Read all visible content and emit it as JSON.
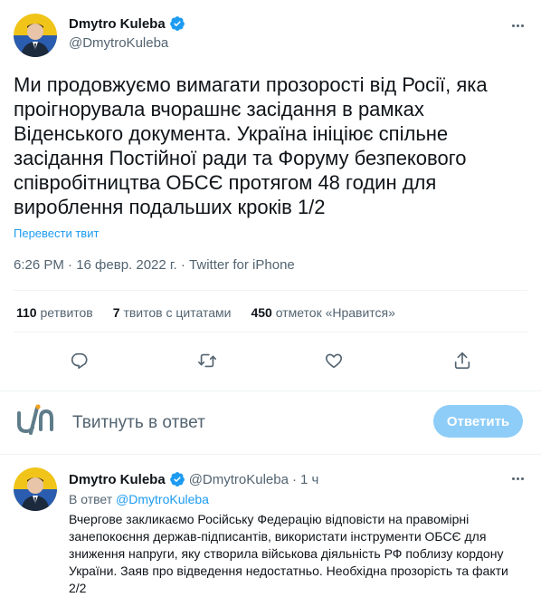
{
  "tweet": {
    "author_name": "Dmytro Kuleba",
    "author_handle": "@DmytroKuleba",
    "text": "Ми продовжуємо вимагати прозорості від Росії, яка проігнорувала вчорашнє засідання в рамках Віденського документа. Україна ініціює спільне засідання Постійної ради та Форуму безпекового співробітництва ОБСЄ протягом 48 годин для вироблення подальших кроків 1/2",
    "translate_label": "Перевести твит",
    "timestamp": "6:26 PM · 16 февр. 2022 г. · Twitter for iPhone",
    "stats": {
      "retweets_count": "110",
      "retweets_label": "ретвитов",
      "quotes_count": "7",
      "quotes_label": "твитов с цитатами",
      "likes_count": "450",
      "likes_label": "отметок «Нравится»"
    },
    "actions": {
      "reply_icon": "reply-icon",
      "retweet_icon": "retweet-icon",
      "like_icon": "heart-icon",
      "share_icon": "share-icon"
    }
  },
  "reply_composer": {
    "placeholder": "Твитнуть в ответ",
    "button_label": "Ответить",
    "button_color": "#8ecdf8"
  },
  "reply_tweet": {
    "author_name": "Dmytro Kuleba",
    "author_handle": "@DmytroKuleba",
    "separator": "·",
    "time": "1 ч",
    "reply_to_prefix": "В ответ",
    "reply_to_handle": "@DmytroKuleba",
    "text": "Вчергове закликаємо Російську Федерацію відповісти на правомірні занепокоєння держав-підписантів, використати інструменти ОБСЄ для зниження напруги, яку створила  військова діяльність РФ поблизу кордону України. Заяв про відведення недостатньо. Необхідна прозорість та факти 2/2"
  },
  "colors": {
    "accent": "#1d9bf0",
    "secondary_text": "#536471",
    "primary_text": "#0f1419",
    "divider": "#eff3f4"
  }
}
